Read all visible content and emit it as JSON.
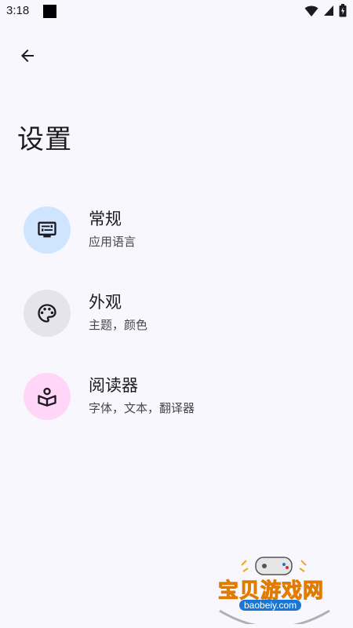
{
  "status_bar": {
    "time": "3:18"
  },
  "header": {
    "title": "设置"
  },
  "settings": {
    "items": [
      {
        "title": "常规",
        "subtitle": "应用语言",
        "icon": "display-settings-icon",
        "icon_bg": "#cfe4ff"
      },
      {
        "title": "外观",
        "subtitle": "主题，颜色",
        "icon": "palette-icon",
        "icon_bg": "#e5e4ea"
      },
      {
        "title": "阅读器",
        "subtitle": "字体，文本，翻译器",
        "icon": "local-library-icon",
        "icon_bg": "#ffd6f8"
      }
    ]
  },
  "watermark": {
    "text": "宝贝游戏网",
    "url": "baobeiy.com"
  },
  "colors": {
    "background": "#f8f7fd",
    "text_primary": "#1c1b1f",
    "text_secondary": "#49454f"
  }
}
